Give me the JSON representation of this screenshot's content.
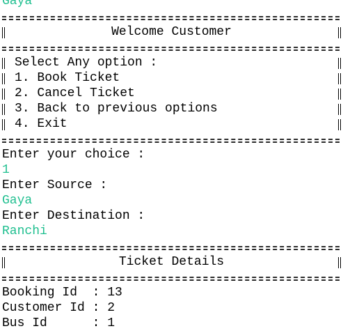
{
  "prev_input": "Gaya",
  "welcome": {
    "title": "Welcome Customer"
  },
  "menu": {
    "heading": "Select Any option :",
    "options": [
      "1. Book Ticket",
      "2. Cancel Ticket",
      "3. Back to previous options",
      "4. Exit"
    ]
  },
  "prompts": {
    "choice_label": "Enter your choice :",
    "choice_value": "1",
    "source_label": "Enter Source :",
    "source_value": "Gaya",
    "destination_label": "Enter Destination :",
    "destination_value": "Ranchi"
  },
  "ticket": {
    "title": "Ticket Details",
    "rows": [
      "Booking Id  : 13",
      "Customer Id : 2",
      "Bus Id      : 1"
    ]
  },
  "colors": {
    "input": "#1fbf8f",
    "text": "#000000",
    "background": "#ffffff"
  }
}
